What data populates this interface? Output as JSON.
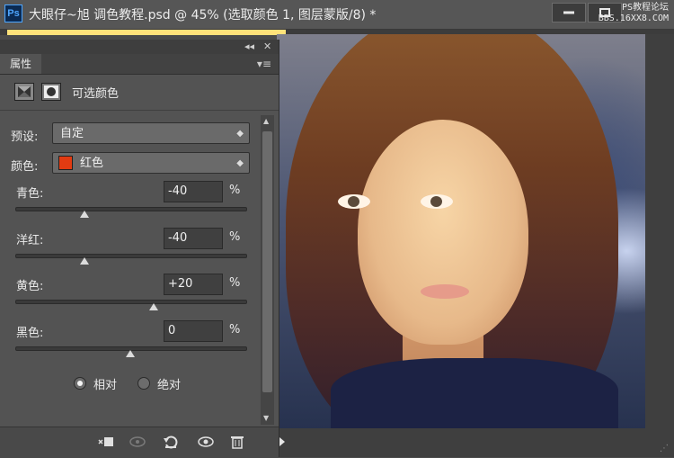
{
  "app": {
    "logo": "Ps",
    "title": "大眼仔~旭 调色教程.psd @ 45% (选取颜色 1, 图层蒙版/8) *"
  },
  "watermark": {
    "line1": "PS教程论坛",
    "line2": "BBS.16XX8.COM"
  },
  "panel": {
    "tab": "属性",
    "layer_name": "可选颜色",
    "preset_label": "预设:",
    "preset_value": "自定",
    "colors_label": "颜色:",
    "colors_value": "红色",
    "swatch_color": "#e23b12",
    "sliders": [
      {
        "label": "青色:",
        "value": "-40",
        "unit": "%",
        "level": -40
      },
      {
        "label": "洋红:",
        "value": "-40",
        "unit": "%",
        "level": -40
      },
      {
        "label": "黄色:",
        "value": "+20",
        "unit": "%",
        "level": 20
      },
      {
        "label": "黑色:",
        "value": "0",
        "unit": "%",
        "level": 0
      }
    ],
    "method": {
      "relative": "相对",
      "absolute": "绝对",
      "selected": "relative"
    }
  },
  "icons": [
    "ps-logo-icon",
    "minimize-icon",
    "restore-icon",
    "collapse-icon",
    "close-icon",
    "panel-menu-icon",
    "adjustment-layer-icon",
    "mask-icon",
    "clip-to-layer-icon",
    "view-previous-icon",
    "reset-icon",
    "visibility-icon",
    "delete-icon"
  ]
}
